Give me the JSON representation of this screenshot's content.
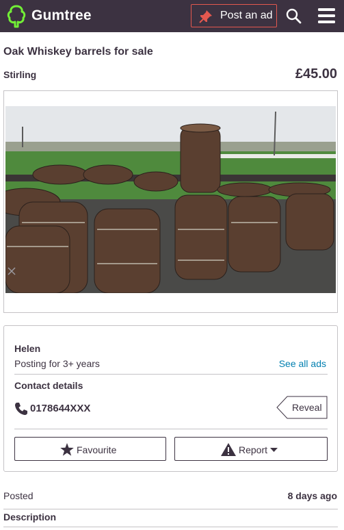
{
  "header": {
    "brand": "Gumtree",
    "post_ad_label": "Post an ad",
    "icons": [
      "gumtree-tree-logo",
      "pin-icon",
      "search-icon",
      "hamburger-menu-icon"
    ]
  },
  "listing": {
    "title": "Oak Whiskey barrels for sale",
    "location": "Stirling",
    "price": "£45.00",
    "photo_subject": "oak whiskey barrels"
  },
  "seller": {
    "name": "Helen",
    "posting_for": "Posting for 3+ years",
    "see_all_label": "See all ads",
    "contact_title": "Contact details",
    "phone": "0178644XXX",
    "reveal_label": "Reveal",
    "favourite_label": "Favourite",
    "report_label": "Report"
  },
  "details": {
    "posted_label": "Posted",
    "posted_value": "8 days ago",
    "description_title": "Description"
  },
  "colors": {
    "header_bg": "#3c3241",
    "logo_green": "#72ef36",
    "accent_red": "#e4584f",
    "link_blue": "#007fb0",
    "text": "#3c3241",
    "border": "#c4c2c5"
  }
}
